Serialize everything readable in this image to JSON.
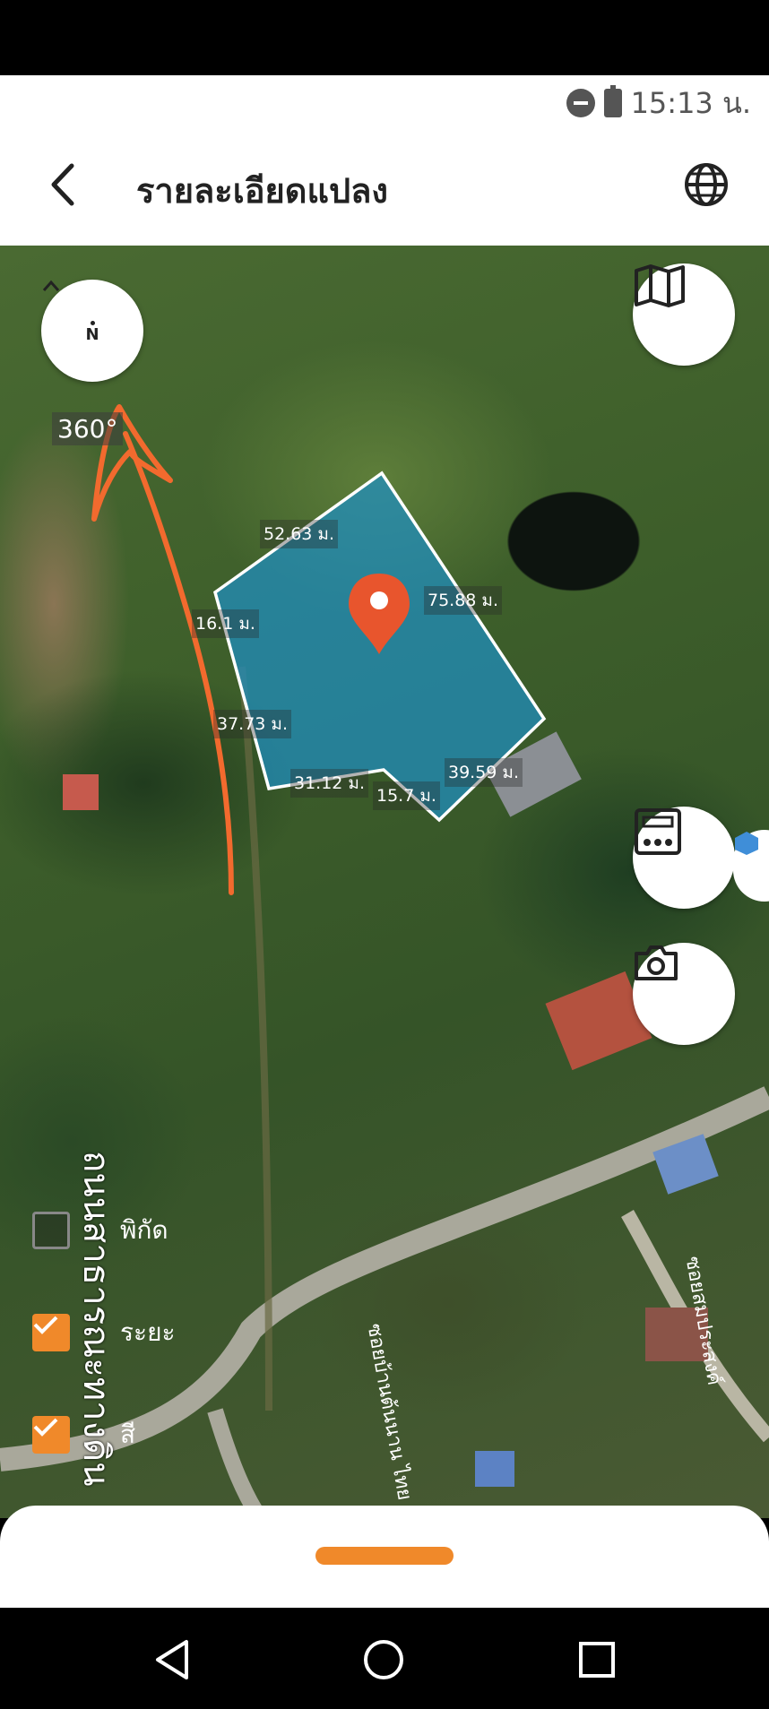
{
  "status_bar": {
    "time": "15:13 น.",
    "icons": [
      "do-not-disturb-icon",
      "battery-charging-icon"
    ]
  },
  "header": {
    "title": "รายละเอียดแปลง",
    "back_icon": "chevron-left-icon",
    "language_icon": "globe-icon"
  },
  "map": {
    "compass": {
      "letters": "N",
      "heading_readout": "360°"
    },
    "layer_button_icon": "map-icon",
    "calculator_button_icon": "calculator-icon",
    "camera_button_icon": "camera-icon",
    "plot": {
      "fill_color": "#1f8fc2",
      "outline_color": "#ffffff",
      "pin_color": "#e8552d",
      "side_lengths": [
        "52.63 ม.",
        "75.88 ม.",
        "16.1 ม.",
        "37.73 ม.",
        "31.12 ม.",
        "15.7 ม.",
        "39.59 ม."
      ]
    },
    "roads": {
      "main_road": "ถนนสาธารณะทางดิน",
      "lane_1": "ซอยสมประสงค์",
      "lane_2": "ซอยบ้านต้นนาน ไทย"
    },
    "annotation_color": "#f26a2e",
    "layers": [
      {
        "label": "พิกัด",
        "checked": false
      },
      {
        "label": "ระยะ",
        "checked": true
      },
      {
        "label": "สี",
        "checked": true
      }
    ]
  },
  "bottom_sheet": {
    "handle_color": "#f0892a"
  },
  "nav_bar": {
    "icons": [
      "back-triangle-icon",
      "home-circle-icon",
      "recents-square-icon"
    ]
  }
}
